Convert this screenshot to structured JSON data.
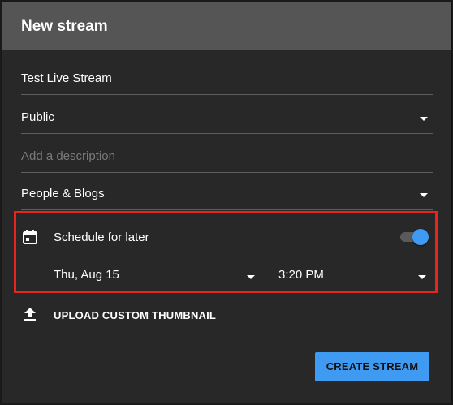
{
  "dialog": {
    "title": "New stream"
  },
  "form": {
    "title_value": "Test Live Stream",
    "visibility_value": "Public",
    "description_placeholder": "Add a description",
    "category_value": "People & Blogs"
  },
  "schedule": {
    "label": "Schedule for later",
    "enabled": true,
    "date_value": "Thu, Aug 15",
    "time_value": "3:20 PM",
    "highlight_color": "#e8251c",
    "toggle_color": "#3f9bf2"
  },
  "thumbnail": {
    "upload_label": "UPLOAD CUSTOM THUMBNAIL"
  },
  "actions": {
    "create_label": "CREATE STREAM",
    "create_color": "#3f9bf2"
  },
  "icons": {
    "calendar": "calendar-icon",
    "upload": "upload-icon",
    "dropdown": "chevron-down-icon"
  }
}
